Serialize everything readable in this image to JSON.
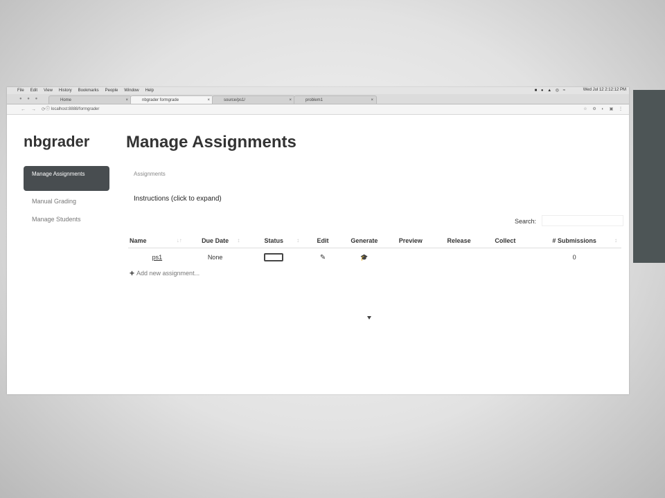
{
  "os_menu": {
    "apple": "",
    "items": [
      "File",
      "Edit",
      "View",
      "History",
      "Bookmarks",
      "People",
      "Window",
      "Help"
    ],
    "status_icons": "■ ● ▲ ◎ ≈",
    "clock": "Wed Jul 12 2:12:12 PM"
  },
  "browser": {
    "traffic_lights": "● ● ●",
    "tabs": [
      {
        "label": "Home",
        "close": "×"
      },
      {
        "label": "nbgrader formgrade",
        "close": "×"
      },
      {
        "label": "source/ps1/",
        "close": "×"
      },
      {
        "label": "problem1",
        "close": "×"
      }
    ],
    "nav_buttons": "← → ⟳",
    "url": "localhost:8888/formgrader",
    "toolbar_icons": "☆ ⚙ ◐ ▣ ⋮"
  },
  "app": {
    "name": "nbgrader"
  },
  "nav": {
    "active": "Manage Assignments",
    "items": [
      "Manual Grading",
      "Manage Students"
    ]
  },
  "main": {
    "title": "Manage Assignments",
    "breadcrumb": "Assignments",
    "instructions": "Instructions (click to expand)",
    "search_label": "Search:",
    "search_value": ""
  },
  "table": {
    "columns": [
      "Name",
      "Due Date",
      "Status",
      "Edit",
      "Generate",
      "Preview",
      "Release",
      "Collect",
      "# Submissions"
    ],
    "sort_glyphs": {
      "name": "↓↑",
      "due": "↕",
      "status": "↕",
      "submissions": "↕"
    },
    "rows": [
      {
        "name": "ps1",
        "due_date": "None",
        "status_icon": "status-box",
        "edit_icon": "✎",
        "generate_icon": "🎓",
        "preview": "",
        "release": "",
        "collect": "",
        "submissions": "0"
      }
    ],
    "add_new": {
      "icon": "+",
      "label": "Add new assignment..."
    }
  }
}
